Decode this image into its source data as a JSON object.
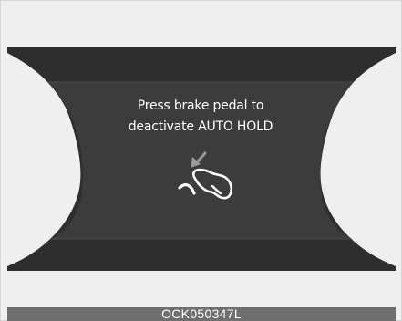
{
  "display": {
    "message_line1": "Press brake pedal to",
    "message_line2": "deactivate AUTO HOLD",
    "icon": "brake-pedal-press-icon"
  },
  "footer": {
    "code": "OCK050347L"
  },
  "colors": {
    "background": "#efefef",
    "display_outer": "#2e2e2e",
    "display_inner": "#3c3c3c",
    "text": "#ffffff",
    "footer_bar": "#6f6f6f"
  }
}
